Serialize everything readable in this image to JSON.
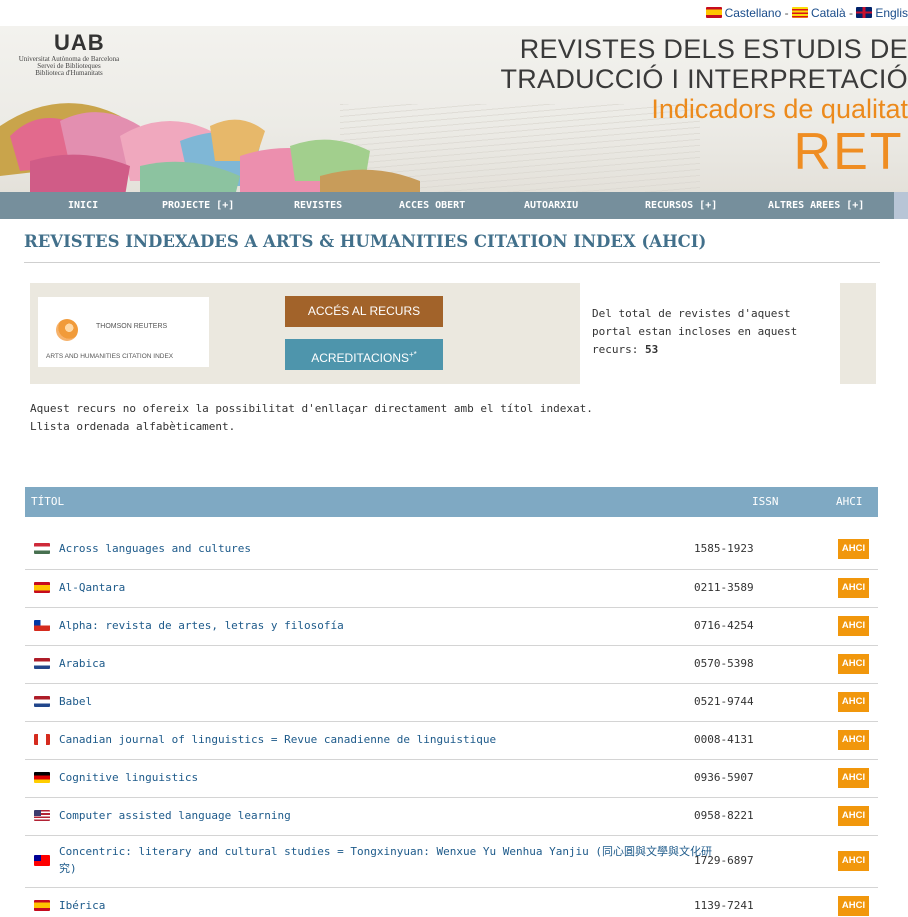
{
  "lang": {
    "items": [
      {
        "label": "Castellano",
        "flag": "es",
        "sep": " - "
      },
      {
        "label": "Català",
        "flag": "cat",
        "sep": " - "
      },
      {
        "label": "Englis",
        "flag": "uk",
        "sep": ""
      }
    ]
  },
  "header": {
    "logo_mark": "UAB",
    "logo_lines": [
      "Universitat Autònoma de Barcelona",
      "Servei de Biblioteques",
      "Biblioteca d'Humanitats"
    ],
    "title_line1": "REVISTES DELS ESTUDIS DE",
    "title_line2": "TRADUCCIÓ I INTERPRETACIÓ",
    "subtitle": "Indicadors de qualitat",
    "acronym": "RETI"
  },
  "nav": [
    {
      "label": "INICI"
    },
    {
      "label": "PROJECTE [+]"
    },
    {
      "label": "REVISTES"
    },
    {
      "label": "ACCES OBERT"
    },
    {
      "label": "AUTOARXIU"
    },
    {
      "label": "RECURSOS [+]"
    },
    {
      "label": "ALTRES AREES [+]"
    }
  ],
  "page_title": "REVISTES INDEXADES A ARTS & HUMANITIES CITATION INDEX (AHCI)",
  "resource": {
    "logo_brand": "THOMSON REUTERS",
    "logo_sub": "ARTS AND HUMANITIES CITATION INDEX",
    "access_button": "ACCÉS AL RECURS",
    "accred_button": "ACREDITACIONS",
    "accred_sup": "+*",
    "info_text": "Del total de revistes d'aquest portal estan incloses en aquest recurs:",
    "info_count": "53"
  },
  "notes": {
    "line1": "Aquest recurs no ofereix la possibilitat d'enllaçar directament amb el títol indexat.",
    "line2": "Llista ordenada alfabèticament."
  },
  "table": {
    "headers": {
      "title": "TÍTOL",
      "issn": "ISSN",
      "ahci": "AHCI"
    },
    "rows": [
      {
        "title": "Across languages and cultures",
        "issn": "1585-1923",
        "badge": "AHCI",
        "flag": "hu"
      },
      {
        "title": "Al-Qantara",
        "issn": "0211-3589",
        "badge": "AHCI",
        "flag": "es"
      },
      {
        "title": "Alpha: revista de artes, letras y filosofía",
        "issn": "0716-4254",
        "badge": "AHCI",
        "flag": "cl"
      },
      {
        "title": "Arabica",
        "issn": "0570-5398",
        "badge": "AHCI",
        "flag": "nl"
      },
      {
        "title": "Babel",
        "issn": "0521-9744",
        "badge": "AHCI",
        "flag": "nl"
      },
      {
        "title": "Canadian journal of linguistics = Revue canadienne de linguistique",
        "issn": "0008-4131",
        "badge": "AHCI",
        "flag": "ca"
      },
      {
        "title": "Cognitive linguistics",
        "issn": "0936-5907",
        "badge": "AHCI",
        "flag": "de"
      },
      {
        "title": "Computer assisted language learning",
        "issn": "0958-8221",
        "badge": "AHCI",
        "flag": "us"
      },
      {
        "title": "Concentric: literary and cultural studies = Tongxinyuan: Wenxue Yu Wenhua Yanjiu (同心圓與文學與文化研究)",
        "issn": "1729-6897",
        "badge": "AHCI",
        "flag": "tw"
      },
      {
        "title": "Ibérica",
        "issn": "1139-7241",
        "badge": "AHCI",
        "flag": "es"
      }
    ]
  },
  "flag_colors": {
    "es": [
      "#c60b1e",
      "#ffc400"
    ],
    "cat": [
      "#fcdd09",
      "#da121a"
    ],
    "uk": [
      "#012169",
      "#c8102e"
    ],
    "hu": [
      "#ce2939",
      "#477050"
    ],
    "cl": [
      "#d52b1e",
      "#0039a6"
    ],
    "nl": [
      "#ae1c28",
      "#21468b"
    ],
    "ca": [
      "#d52b1e",
      "#ffffff"
    ],
    "de": [
      "#000000",
      "#dd0000",
      "#ffce00"
    ],
    "us": [
      "#b22234",
      "#3c3b6e"
    ],
    "tw": [
      "#fe0000",
      "#000095"
    ]
  }
}
